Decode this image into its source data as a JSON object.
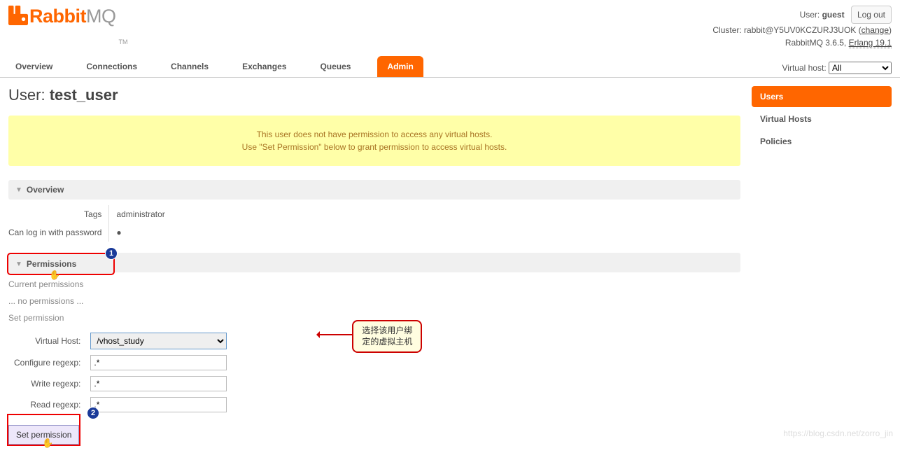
{
  "header": {
    "brand_rabbit": "Rabbit",
    "brand_mq": "MQ",
    "tm": "TM",
    "user_label": "User:",
    "user": "guest",
    "cluster_label": "Cluster:",
    "cluster": "rabbit@Y5UV0KCZURJ3UOK",
    "change": "change",
    "version_prefix": "RabbitMQ 3.6.5,",
    "erlang": "Erlang 19.1",
    "logout": "Log out"
  },
  "tabs": {
    "items": [
      "Overview",
      "Connections",
      "Channels",
      "Exchanges",
      "Queues",
      "Admin"
    ],
    "active_index": 5
  },
  "vhost": {
    "label": "Virtual host:",
    "selected": "All"
  },
  "page": {
    "title_prefix": "User:",
    "title_user": "test_user"
  },
  "warning": {
    "line1": "This user does not have permission to access any virtual hosts.",
    "line2": "Use \"Set Permission\" below to grant permission to access virtual hosts."
  },
  "overview": {
    "header": "Overview",
    "tags_label": "Tags",
    "tags_value": "administrator",
    "login_label": "Can log in with password",
    "login_value": "●"
  },
  "permissions": {
    "header": "Permissions",
    "current_label": "Current permissions",
    "none": "... no permissions ...",
    "set_label": "Set permission",
    "vhost_label": "Virtual Host:",
    "vhost_value": "/vhost_study",
    "configure_label": "Configure regexp:",
    "configure_value": ".*",
    "write_label": "Write regexp:",
    "write_value": ".*",
    "read_label": "Read regexp:",
    "read_value": ".*",
    "button": "Set permission"
  },
  "annotation": {
    "text": "选择该用户绑\n定的虚拟主机",
    "badge1": "1",
    "badge2": "2"
  },
  "sidebar": {
    "items": [
      "Users",
      "Virtual Hosts",
      "Policies"
    ],
    "active_index": 0
  },
  "watermark": "https://blog.csdn.net/zorro_jin"
}
